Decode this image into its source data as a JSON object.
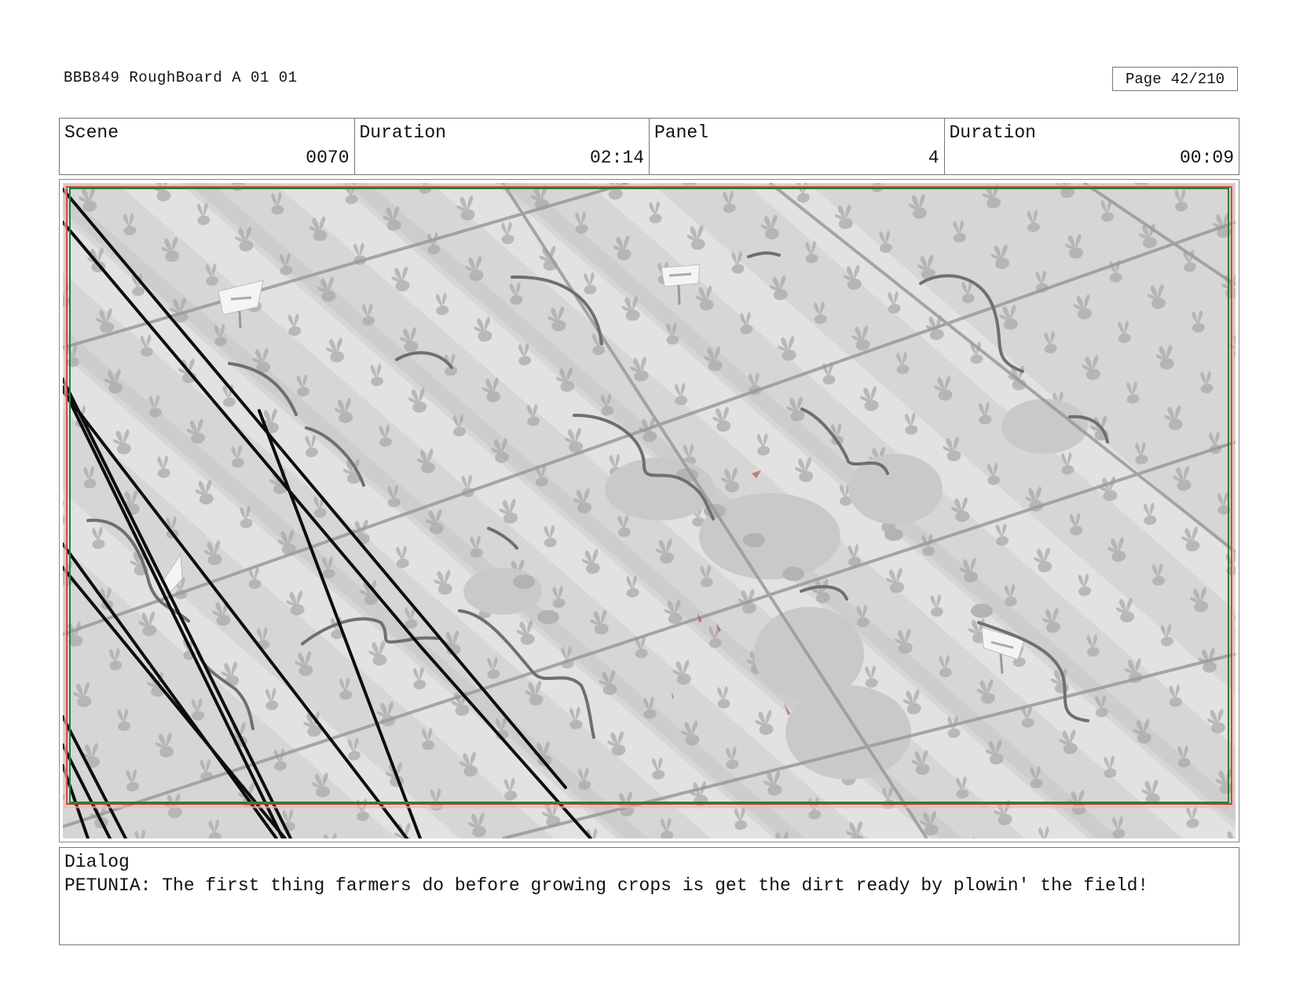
{
  "document": {
    "title": "BBB849 RoughBoard A 01 01",
    "page_label": "Page",
    "page_value": "42/210"
  },
  "info_bar": {
    "scene_label": "Scene",
    "scene_value": "0070",
    "scene_duration_label": "Duration",
    "scene_duration_value": "02:14",
    "panel_label": "Panel",
    "panel_value": "4",
    "panel_duration_label": "Duration",
    "panel_duration_value": "00:09"
  },
  "dialog": {
    "label": "Dialog",
    "text": "PETUNIA: The first thing farmers do before growing crops is get the dirt ready by plowin' the field!"
  },
  "colors": {
    "safe_frame_red": "#c0392b",
    "safe_frame_green": "#2e7d32",
    "field_base": "#d4d4d4",
    "field_row_light": "#e6e6e6",
    "sketch_line": "#111111",
    "grey_stroke": "#7a7a7a"
  }
}
